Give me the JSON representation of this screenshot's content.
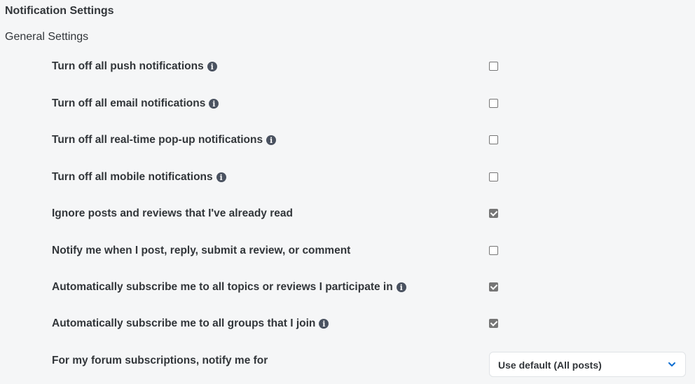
{
  "page": {
    "title": "Notification Settings",
    "section_title": "General Settings"
  },
  "settings": [
    {
      "label": "Turn off all push notifications",
      "has_info": true,
      "checked": false
    },
    {
      "label": "Turn off all email notifications",
      "has_info": true,
      "checked": false
    },
    {
      "label": "Turn off all real-time pop-up notifications",
      "has_info": true,
      "checked": false
    },
    {
      "label": "Turn off all mobile notifications",
      "has_info": true,
      "checked": false
    },
    {
      "label": "Ignore posts and reviews that I've already read",
      "has_info": false,
      "checked": true
    },
    {
      "label": "Notify me when I post, reply, submit a review, or comment",
      "has_info": false,
      "checked": false
    },
    {
      "label": "Automatically subscribe me to all topics or reviews I participate in",
      "has_info": true,
      "checked": true
    },
    {
      "label": "Automatically subscribe me to all groups that I join",
      "has_info": true,
      "checked": true
    }
  ],
  "forum_subscription": {
    "label": "For my forum subscriptions, notify me for",
    "selected": "Use default (All posts)"
  },
  "icons": {
    "info": "info-icon",
    "dropdown": "chevron-down-icon"
  },
  "colors": {
    "background": "#f5f6f7",
    "text": "#32363a",
    "checkbox_checked": "#767676",
    "accent": "#0a6ed1"
  }
}
